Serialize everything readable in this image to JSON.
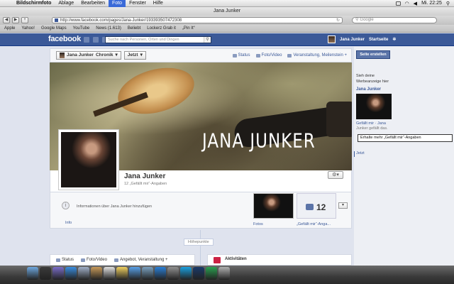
{
  "menubar": {
    "items": [
      "Bildschirmfoto",
      "Ablage",
      "Bearbeiten",
      "Foto",
      "Fenster",
      "Hilfe"
    ],
    "time": "Mi. 22:25"
  },
  "window": {
    "title": "Jana Junker"
  },
  "browser": {
    "url": "http://www.facebook.com/pages/Jana-Junker/193393507472308",
    "search_placeholder": "Google",
    "bookmarks": [
      "Apple",
      "Yahoo!",
      "Google Maps",
      "YouTube",
      "News (1.613)",
      "Beliebt",
      "Lockerz Grab it",
      "„Pin It“"
    ]
  },
  "fb": {
    "logo": "facebook",
    "search_placeholder": "Suche nach Personen, Orten und Dingen",
    "user": "Jana Junker",
    "home": "Startseite"
  },
  "timeline_bar": {
    "name": "Jana Junker",
    "chronik": "Chronik",
    "jetzt": "Jetzt",
    "actions": [
      "Status",
      "Foto/Video",
      "Veranstaltung, Meilenstein +"
    ]
  },
  "cover": {
    "text": "JANA JUNKER"
  },
  "profile": {
    "name": "Jana Junker",
    "likes": "12 „Gefällt mir“-Angaben"
  },
  "about": {
    "text": "Informationen über Jana Junker hinzufügen",
    "info_label": "Info",
    "photos_label": "Fotos",
    "like_count": "12",
    "likes_label": "„Gefällt mir“-Anga..."
  },
  "highlights": "Höhepunkte",
  "composer": {
    "actions": [
      "Status",
      "Foto/Video",
      "Angebot, Veranstaltung +"
    ]
  },
  "activity": {
    "title": "Aktivitäten"
  },
  "right": {
    "create_button": "Seite erstellen",
    "ad_heading_1": "Sieh deine",
    "ad_heading_2": "Werbeanzeige hier",
    "ad_name": "Jana Junker",
    "ad_like_1": "Gefällt mir · Jana",
    "ad_like_2": "Junker gefällt das.",
    "tooltip": "Erhalte mehr „Gefällt mir“-Angaben",
    "jetzt": "Jetzt"
  },
  "colors": {
    "facebook_blue": "#3b5998",
    "page_bg": "#dfe3ee"
  },
  "dock_icons": [
    "finder-icon",
    "dashboard-icon",
    "mission-control-icon",
    "safari-icon",
    "mail-icon",
    "contacts-icon",
    "calendar-icon",
    "notes-icon",
    "itunes-icon",
    "iphoto-icon",
    "app-store-icon",
    "preferences-icon",
    "skype-icon",
    "photoshop-icon",
    "spotify-icon",
    "trash-icon"
  ]
}
